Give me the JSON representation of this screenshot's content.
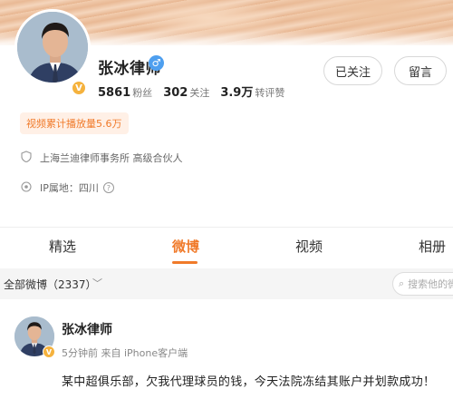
{
  "profile": {
    "name": "张冰律师",
    "gender_icon": "male-icon",
    "verified_icon": "verified-v-icon",
    "stats": [
      {
        "num": "5861",
        "label": "粉丝"
      },
      {
        "num": "302",
        "label": "关注"
      },
      {
        "num": "3.9万",
        "label": "转评赞"
      }
    ],
    "followed_label": "已关注",
    "message_label": "留言",
    "play_badge": "视频累计播放量5.6万",
    "company": "上海兰迪律师事务所 高级合伙人",
    "ip_location": "IP属地：四川"
  },
  "tabs": [
    {
      "label": "精选"
    },
    {
      "label": "微博"
    },
    {
      "label": "视频"
    },
    {
      "label": "相册"
    }
  ],
  "active_tab": "微博",
  "filter": {
    "label": "全部微博（2337）",
    "search_placeholder": "搜索他的微博"
  },
  "post": {
    "author": "张冰律师",
    "meta": "5分钟前 来自 iPhone客户端",
    "text": "某中超俱乐部，欠我代理球员的钱，今天法院冻结其账户并划款成功！"
  },
  "colors": {
    "accent": "#f07a2a",
    "verified": "#f5b23d",
    "gender_male": "#4e9fef"
  }
}
